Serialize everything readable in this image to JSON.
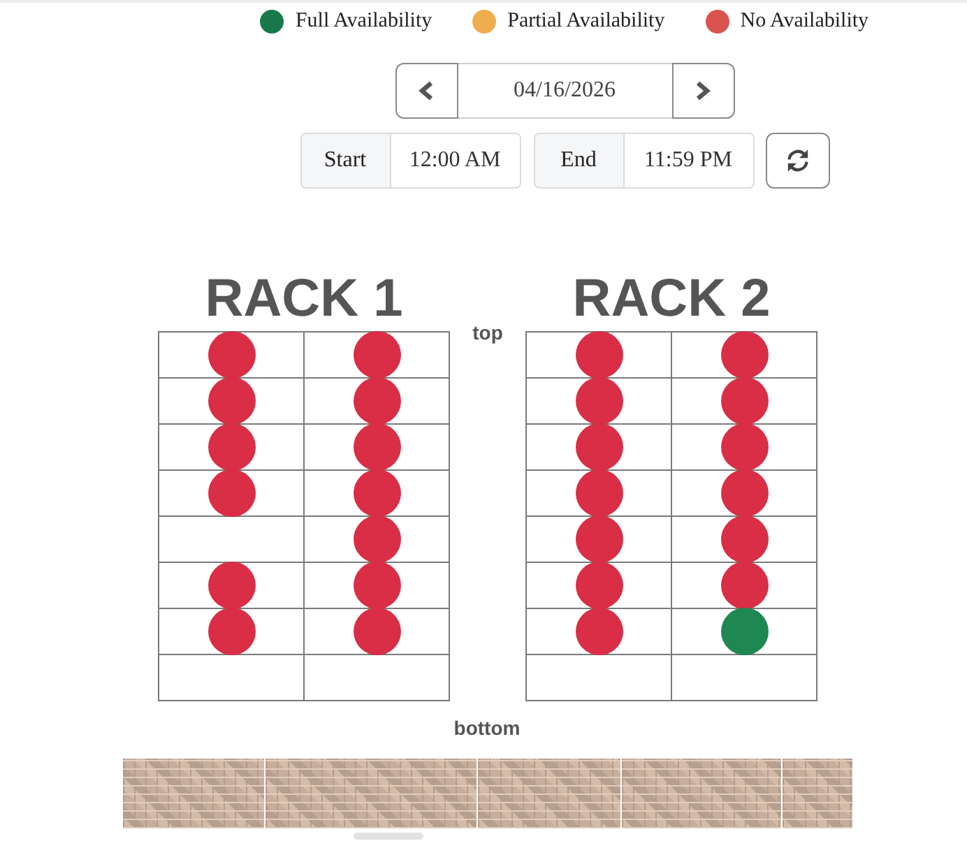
{
  "legend": [
    {
      "label": "Full Availability",
      "color": "#17794a"
    },
    {
      "label": "Partial Availability",
      "color": "#f0ad4e"
    },
    {
      "label": "No Availability",
      "color": "#d9534f"
    }
  ],
  "date_picker": {
    "value": "04/16/2026"
  },
  "time_range": [
    {
      "label": "Start",
      "value": "12:00 AM"
    },
    {
      "label": "End",
      "value": "11:59 PM"
    }
  ],
  "top_label": "top",
  "racks": [
    {
      "title": "RACK 1",
      "rows": [
        {
          "slots": [
            {
              "occupied": true,
              "color": "#d92e45"
            },
            {
              "occupied": true,
              "color": "#d92e45"
            }
          ]
        },
        {
          "slots": [
            {
              "occupied": true,
              "color": "#d92e45"
            },
            {
              "occupied": true,
              "color": "#d92e45"
            }
          ]
        },
        {
          "slots": [
            {
              "occupied": true,
              "color": "#d92e45"
            },
            {
              "occupied": true,
              "color": "#d92e45"
            }
          ]
        },
        {
          "slots": [
            {
              "occupied": true,
              "color": "#d92e45"
            },
            {
              "occupied": true,
              "color": "#d92e45"
            }
          ]
        },
        {
          "slots": [
            {
              "occupied": false
            },
            {
              "occupied": true,
              "color": "#d92e45"
            }
          ]
        },
        {
          "slots": [
            {
              "occupied": true,
              "color": "#d92e45"
            },
            {
              "occupied": true,
              "color": "#d92e45"
            }
          ]
        },
        {
          "slots": [
            {
              "occupied": true,
              "color": "#d92e45"
            },
            {
              "occupied": true,
              "color": "#d92e45"
            }
          ]
        },
        {
          "slots": [
            {
              "occupied": false
            },
            {
              "occupied": false
            }
          ]
        }
      ]
    },
    {
      "title": "RACK 2",
      "rows": [
        {
          "slots": [
            {
              "occupied": true,
              "color": "#d92e45"
            },
            {
              "occupied": true,
              "color": "#d92e45"
            }
          ]
        },
        {
          "slots": [
            {
              "occupied": true,
              "color": "#d92e45"
            },
            {
              "occupied": true,
              "color": "#d92e45"
            }
          ]
        },
        {
          "slots": [
            {
              "occupied": true,
              "color": "#d92e45"
            },
            {
              "occupied": true,
              "color": "#d92e45"
            }
          ]
        },
        {
          "slots": [
            {
              "occupied": true,
              "color": "#d92e45"
            },
            {
              "occupied": true,
              "color": "#d92e45"
            }
          ]
        },
        {
          "slots": [
            {
              "occupied": true,
              "color": "#d92e45"
            },
            {
              "occupied": true,
              "color": "#d92e45"
            }
          ]
        },
        {
          "slots": [
            {
              "occupied": true,
              "color": "#d92e45"
            },
            {
              "occupied": true,
              "color": "#d92e45"
            }
          ]
        },
        {
          "slots": [
            {
              "occupied": true,
              "color": "#d92e45"
            },
            {
              "occupied": true,
              "color": "#1e8752"
            }
          ]
        },
        {
          "slots": [
            {
              "occupied": false
            },
            {
              "occupied": false
            }
          ]
        }
      ]
    }
  ],
  "bottom_label": "bottom"
}
